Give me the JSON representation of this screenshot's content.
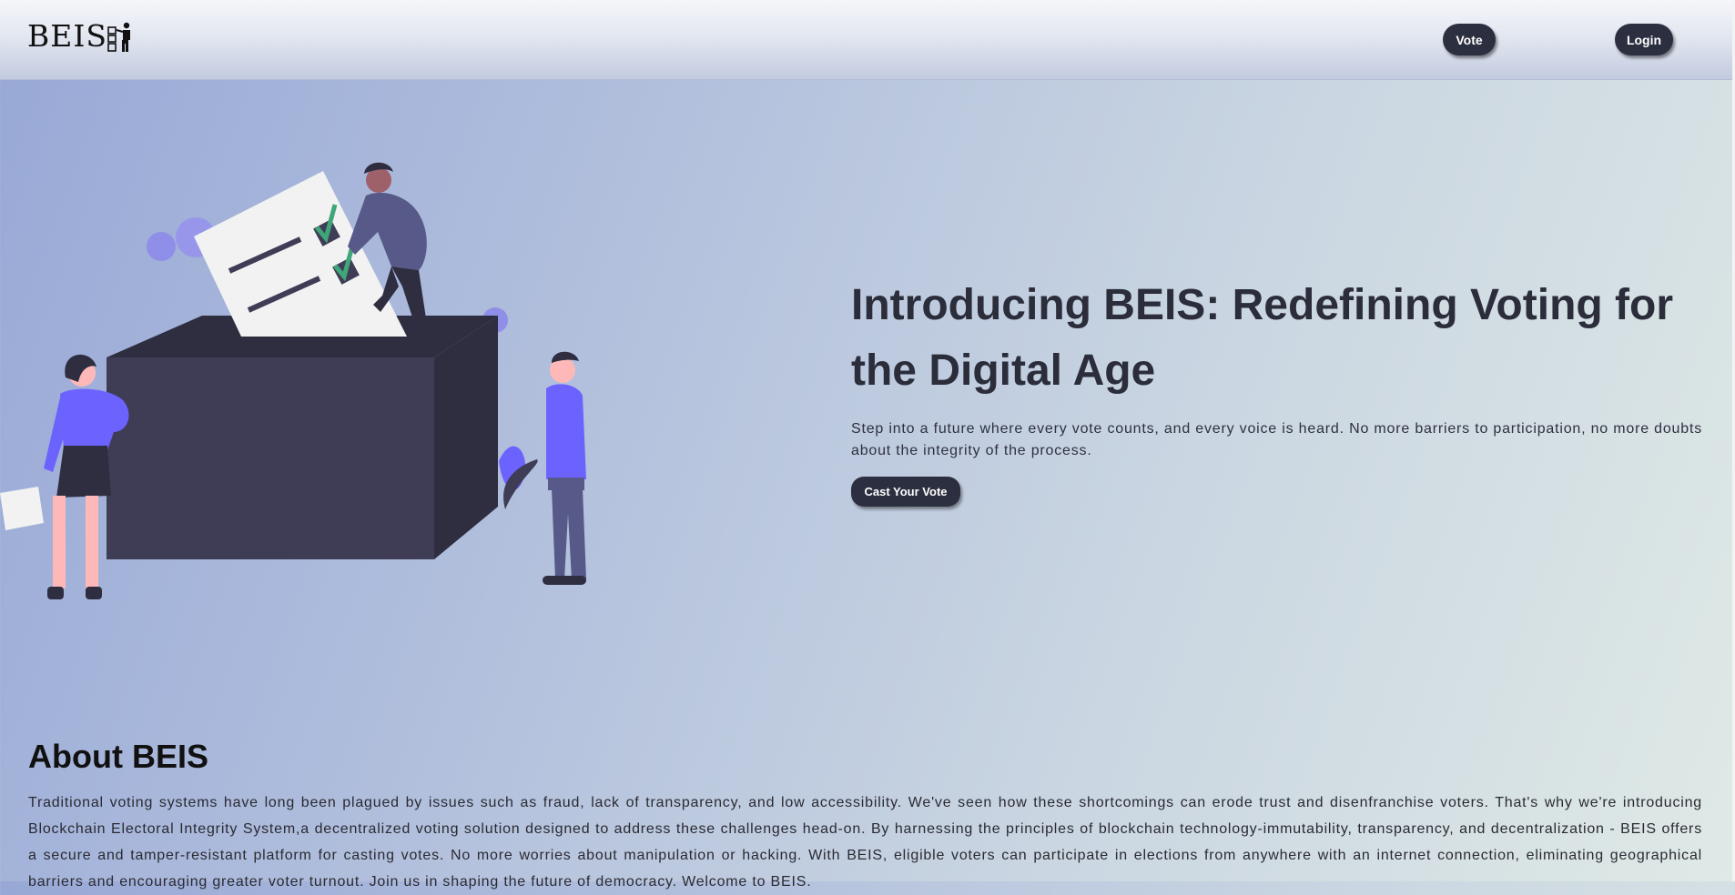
{
  "header": {
    "logo_text": "BEIS",
    "vote_label": "Vote",
    "login_label": "Login"
  },
  "hero": {
    "title": "Introducing BEIS: Redefining Voting for the Digital Age",
    "text": "Step into a future where every vote counts, and every voice is heard. No more barriers to participation, no more doubts about the integrity of the process.",
    "cta_label": "Cast Your Vote"
  },
  "about": {
    "title": "About BEIS",
    "text": "Traditional voting systems have long been plagued by issues such as fraud, lack of transparency, and low accessibility. We've seen how these shortcomings can erode trust and disenfranchise voters. That's why we're introducing Blockchain Electoral Integrity System,a decentralized voting solution designed to address these challenges head-on. By harnessing the principles of blockchain technology-immutability, transparency, and decentralization - BEIS offers a secure and tamper-resistant platform for casting votes. No more worries about manipulation or hacking. With BEIS, eligible voters can participate in elections from anywhere with an internet connection, eliminating geographical barriers and encouraging greater voter turnout. Join us in shaping the future of democracy. Welcome to BEIS."
  },
  "colors": {
    "button_bg": "#2c2f3f",
    "accent_purple": "#6c63ff",
    "box_dark": "#3f3d56",
    "check_green": "#3fa679"
  },
  "icons": {
    "logo": "voter-ballot-icon",
    "illustration": "ballot-box-illustration"
  }
}
